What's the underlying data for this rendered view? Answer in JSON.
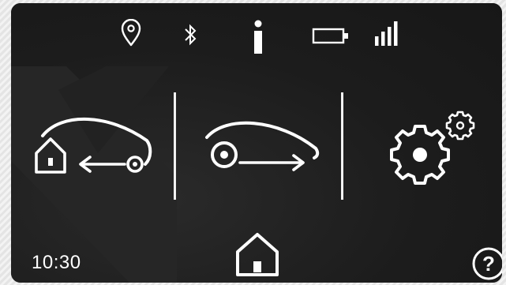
{
  "status_bar": {
    "icons": [
      "location-icon",
      "bluetooth-icon",
      "info-icon",
      "battery-icon",
      "signal-strength-icon"
    ]
  },
  "actions": {
    "park_home": {
      "icon": "mower-return-home-icon"
    },
    "start_mowing": {
      "icon": "mower-drive-forward-icon"
    },
    "settings": {
      "icon": "settings-gears-icon"
    },
    "home": {
      "icon": "home-icon"
    }
  },
  "footer": {
    "time": "10:30",
    "help_label": "?"
  },
  "colors": {
    "background": "#1d1d1d",
    "foreground": "#ffffff",
    "bezel": "#ececec"
  }
}
